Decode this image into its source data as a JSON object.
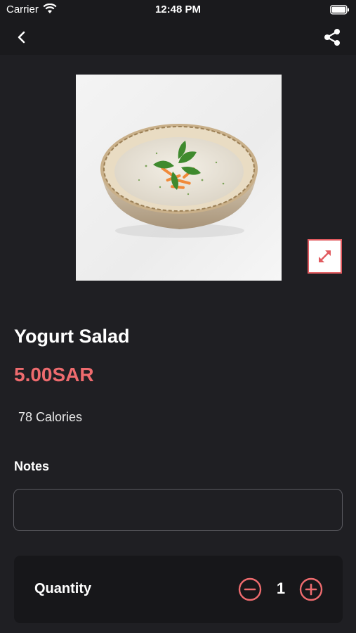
{
  "status_bar": {
    "carrier": "Carrier",
    "time": "12:48 PM",
    "wifi_icon": "wifi-icon",
    "battery_icon": "battery-icon"
  },
  "nav": {
    "back_icon": "chevron-left-icon",
    "share_icon": "share-icon"
  },
  "product": {
    "image_description_icon": "soup-bowl-image",
    "name": "Yogurt Salad",
    "price": "5.00SAR",
    "calories": "78 Calories"
  },
  "notes": {
    "label": "Notes",
    "value": "",
    "placeholder": ""
  },
  "quantity": {
    "label": "Quantity",
    "value": "1"
  },
  "colors": {
    "accent": "#ee6b6e",
    "background": "#1f1f23",
    "card": "#17171a"
  }
}
